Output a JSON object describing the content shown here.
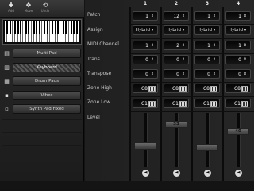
{
  "toolbar": {
    "buttons": [
      {
        "icon": "✚",
        "label": "Add"
      },
      {
        "icon": "✥",
        "label": "Move"
      },
      {
        "icon": "⟲",
        "label": "Undo"
      }
    ]
  },
  "instruments": [
    {
      "icon": "▤",
      "label": "Multi Pad",
      "selected": false
    },
    {
      "icon": "▥",
      "label": "Keyboard",
      "selected": true
    },
    {
      "icon": "▦",
      "label": "Drum Pads",
      "selected": false
    },
    {
      "icon": "▪",
      "label": "Vibes",
      "selected": false
    },
    {
      "icon": "▫",
      "label": "Synth Pad Fixed",
      "selected": false
    }
  ],
  "grid": {
    "column_headers": [
      "1",
      "2",
      "3",
      "4"
    ],
    "row_labels": [
      "Patch",
      "Assign",
      "MIDI Channel",
      "Trans",
      "Transpose",
      "Zone High",
      "Zone Low",
      "Level"
    ],
    "columns": [
      {
        "patch": "1",
        "assign": "Hybrid",
        "midi_channel": "1",
        "trans": "0",
        "transpose": "0",
        "zone_high": "C8",
        "zone_low": "C1",
        "level": "",
        "level_value": 0.37
      },
      {
        "patch": "12",
        "assign": "Hybrid",
        "midi_channel": "2",
        "trans": "0",
        "transpose": "0",
        "zone_high": "C8",
        "zone_low": "C1",
        "level": "33",
        "level_value": 0.82
      },
      {
        "patch": "1",
        "assign": "Hybrid",
        "midi_channel": "1",
        "trans": "0",
        "transpose": "0",
        "zone_high": "C8",
        "zone_low": "C1",
        "level": "",
        "level_value": 0.32
      },
      {
        "patch": "1",
        "assign": "Hybrid",
        "midi_channel": "1",
        "trans": "0",
        "transpose": "0",
        "zone_high": "C8",
        "zone_low": "C1",
        "level": "40",
        "level_value": 0.67
      }
    ],
    "arrow_spinner": "⇕",
    "arrow_dropdown": "▾",
    "speaker_icon": "◀"
  }
}
